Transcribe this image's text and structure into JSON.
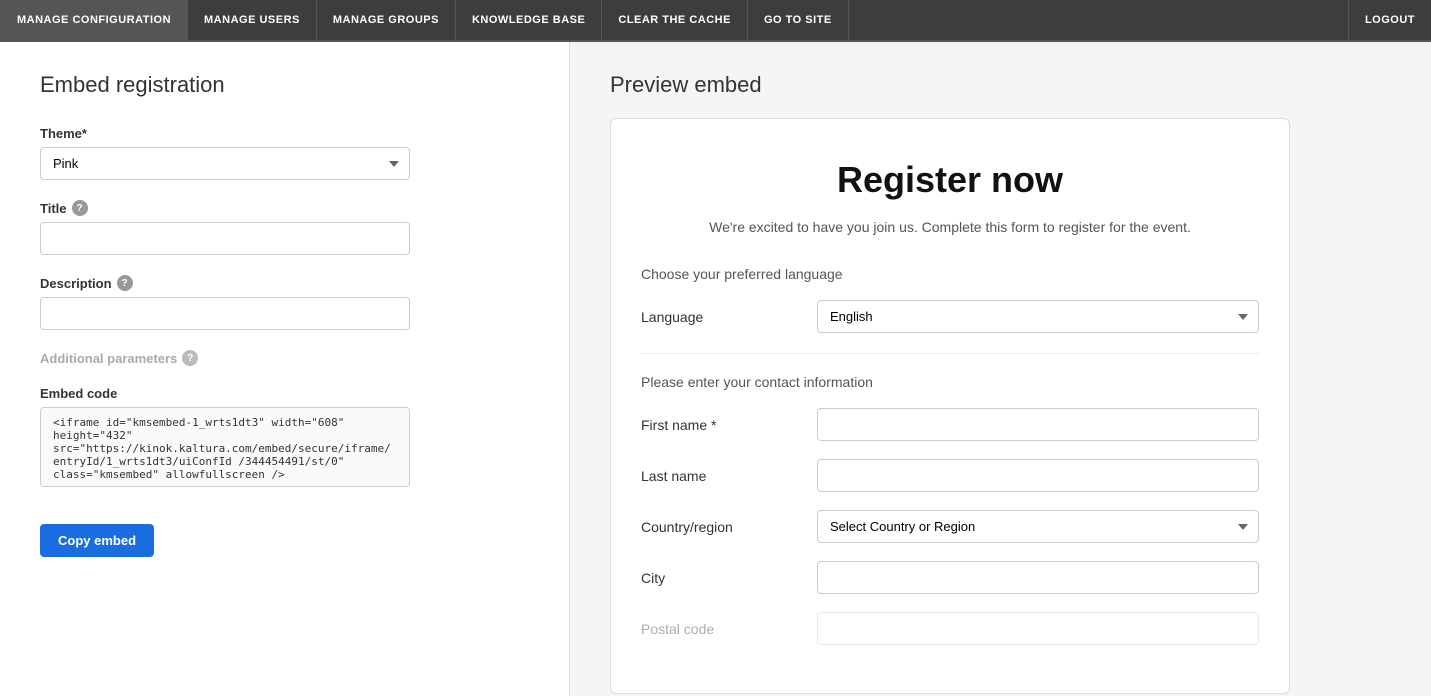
{
  "nav": {
    "items": [
      {
        "id": "manage-configuration",
        "label": "MANAGE CONFIGURATION"
      },
      {
        "id": "manage-users",
        "label": "MANAGE USERS"
      },
      {
        "id": "manage-groups",
        "label": "MANAGE GROUPS"
      },
      {
        "id": "knowledge-base",
        "label": "KNOWLEDGE BASE"
      },
      {
        "id": "clear-cache",
        "label": "CLEAR THE CACHE"
      },
      {
        "id": "go-to-site",
        "label": "GO TO SITE"
      }
    ],
    "logout_label": "LOGOUT"
  },
  "left_panel": {
    "title": "Embed registration",
    "theme_label": "Theme*",
    "theme_value": "Pink",
    "title_field_label": "Title",
    "description_label": "Description",
    "additional_params_label": "Additional parameters",
    "embed_code_label": "Embed code",
    "embed_code_value": "<iframe id=\"kmsembed-1_wrts1dt3\" width=\"608\" height=\"432\" src=\"https://kinok.kaltura.com/embed/secure/iframe/entryId/1_wrts1dt3/uiConfId /344454491/st/0\" class=\"kmsembed\" allowfullscreen />",
    "copy_embed_label": "Copy embed"
  },
  "right_panel": {
    "title": "Preview embed",
    "register_title": "Register now",
    "register_subtitle": "We're excited to have you join us. Complete this form to register for the event.",
    "language_section_label": "Choose your preferred language",
    "language_label": "Language",
    "language_value": "English",
    "contact_section_label": "Please enter your contact information",
    "first_name_label": "First name *",
    "last_name_label": "Last name",
    "country_region_label": "Country/region",
    "country_region_placeholder": "Select Country or Region",
    "city_label": "City",
    "postal_code_label": "Postal code"
  },
  "icons": {
    "help": "?",
    "chevron_down": "▾"
  }
}
